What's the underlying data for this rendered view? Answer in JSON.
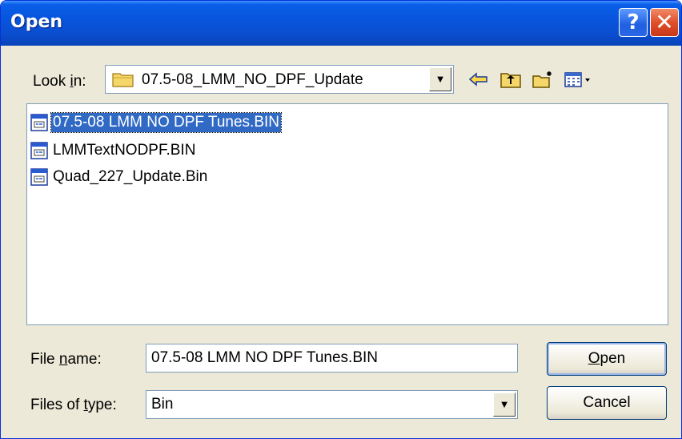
{
  "window": {
    "title": "Open",
    "help_glyph": "?",
    "close_glyph": "✕"
  },
  "toolbar": {
    "look_in_label": "Look in:",
    "look_in_value": "07.5-08_LMM_NO_DPF_Update",
    "icons": [
      "folder-icon",
      "back-arrow-icon",
      "up-one-level-icon",
      "new-folder-icon",
      "view-menu-icon"
    ]
  },
  "files": [
    {
      "name": "07.5-08 LMM NO DPF Tunes.BIN",
      "selected": true,
      "icon": "bin-file-icon"
    },
    {
      "name": "LMMTextNODPF.BIN",
      "selected": false,
      "icon": "bin-file-icon"
    },
    {
      "name": "Quad_227_Update.Bin",
      "selected": false,
      "icon": "bin-file-icon"
    }
  ],
  "form": {
    "file_name_label": "File name:",
    "file_name_value": "07.5-08 LMM NO DPF Tunes.BIN",
    "files_of_type_label": "Files of type:",
    "files_of_type_value": "Bin"
  },
  "buttons": {
    "open": "Open",
    "cancel": "Cancel"
  },
  "colors": {
    "titlebar": "#0855dd",
    "selection": "#316ac5",
    "dialog_bg": "#ece9d8"
  }
}
